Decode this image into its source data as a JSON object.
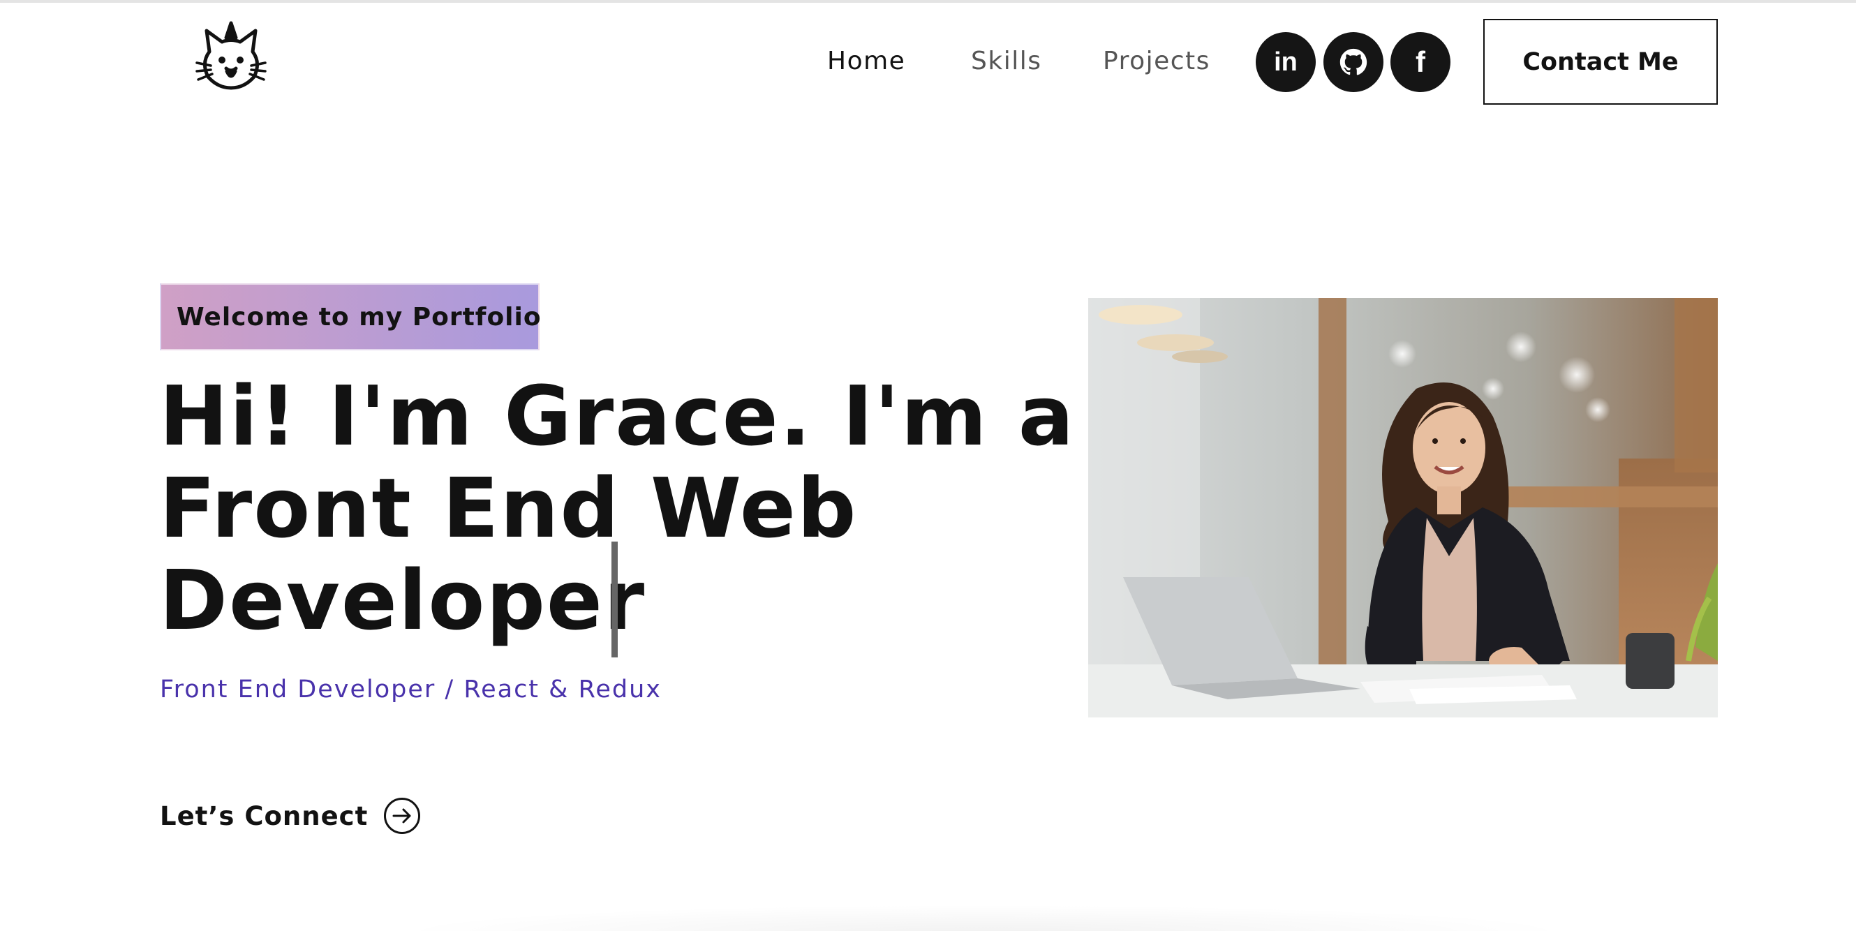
{
  "nav": {
    "links": [
      {
        "label": "Home",
        "active": true
      },
      {
        "label": "Skills",
        "active": false
      },
      {
        "label": "Projects",
        "active": false
      }
    ],
    "social": [
      {
        "icon": "linkedin-icon",
        "glyph": "in"
      },
      {
        "icon": "github-icon"
      },
      {
        "icon": "facebook-icon",
        "glyph": "f"
      }
    ],
    "contact_label": "Contact Me"
  },
  "hero": {
    "tagline": "Welcome to my Portfolio",
    "headline_lines": [
      "Hi! I'm Grace. I'm a",
      "Front End Web",
      "Developer"
    ],
    "subtitle": "Front End Developer / React & Redux",
    "connect_label": "Let’s Connect",
    "connect_icon": "arrow-right-circle-icon",
    "photo_icon": "hero-photo"
  },
  "colors": {
    "text": "#121212",
    "accent": "#4932ab",
    "tagline_gradient_start": "#d2a0c4",
    "tagline_gradient_end": "#a499e0",
    "social_bg": "#151515"
  }
}
